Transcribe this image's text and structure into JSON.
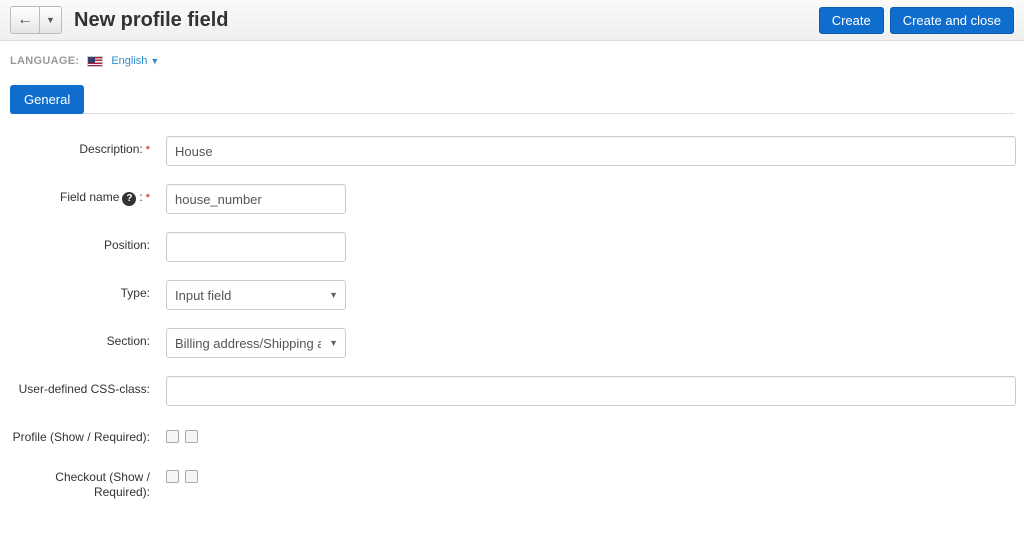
{
  "header": {
    "title": "New profile field",
    "create_label": "Create",
    "create_close_label": "Create and close"
  },
  "language": {
    "label": "LANGUAGE:",
    "current": "English"
  },
  "tabs": {
    "general": "General"
  },
  "form": {
    "description": {
      "label": "Description:",
      "value": "House",
      "required": true
    },
    "field_name": {
      "label": "Field name",
      "value": "house_number",
      "required": true
    },
    "position": {
      "label": "Position:",
      "value": ""
    },
    "type": {
      "label": "Type:",
      "selected": "Input field"
    },
    "section": {
      "label": "Section:",
      "selected": "Billing address/Shipping address"
    },
    "css_class": {
      "label": "User-defined CSS-class:",
      "value": ""
    },
    "profile": {
      "label": "Profile (Show / Required):"
    },
    "checkout": {
      "label": "Checkout (Show / Required):"
    }
  }
}
